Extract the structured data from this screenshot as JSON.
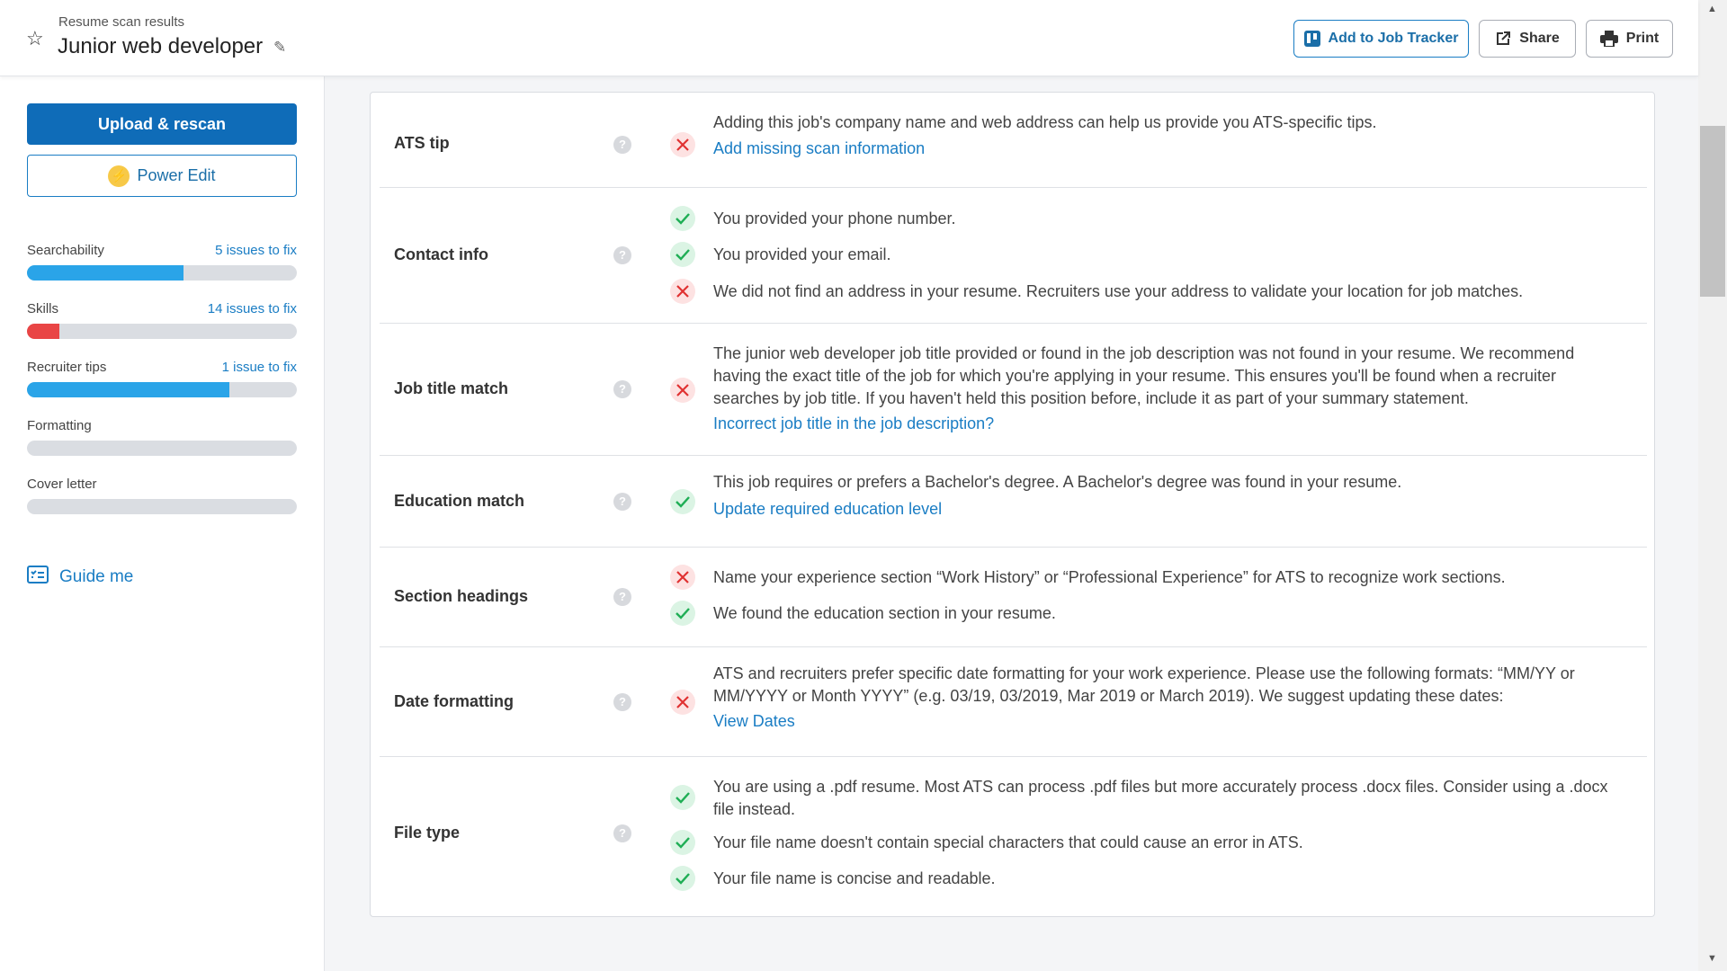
{
  "header": {
    "subtitle": "Resume scan results",
    "title": "Junior web developer",
    "buttons": {
      "job_tracker": "Add to Job Tracker",
      "share": "Share",
      "print": "Print"
    }
  },
  "sidebar": {
    "upload_label": "Upload & rescan",
    "power_edit_label": "Power Edit",
    "metrics": [
      {
        "label": "Searchability",
        "issues": "5 issues to fix",
        "progress": 0.58,
        "color": "#2aa4e8"
      },
      {
        "label": "Skills",
        "issues": "14 issues to fix",
        "progress": 0.12,
        "color": "#e94545"
      },
      {
        "label": "Recruiter tips",
        "issues": "1 issue to fix",
        "progress": 0.75,
        "color": "#2aa4e8"
      },
      {
        "label": "Formatting",
        "issues": "",
        "progress": 0,
        "color": "#2aa4e8"
      },
      {
        "label": "Cover letter",
        "issues": "",
        "progress": 0,
        "color": "#2aa4e8"
      }
    ],
    "guide_label": "Guide me"
  },
  "results": [
    {
      "label": "ATS tip",
      "items": [
        {
          "status": "fail",
          "text": "Adding this job's company name and web address can help us provide you ATS-specific tips."
        }
      ],
      "link": "Add missing scan information"
    },
    {
      "label": "Contact info",
      "items": [
        {
          "status": "pass",
          "text": "You provided your phone number."
        },
        {
          "status": "pass",
          "text": "You provided your email."
        },
        {
          "status": "fail",
          "text": "We did not find an address in your resume. Recruiters use your address to validate your location for job matches."
        }
      ]
    },
    {
      "label": "Job title match",
      "items": [
        {
          "status": "fail",
          "text": "The junior web developer job title provided or found in the job description was not found in your resume. We recommend having the exact title of the job for which you're applying in your resume. This ensures you'll be found when a recruiter searches by job title. If you haven't held this position before, include it as part of your summary statement."
        }
      ],
      "link": "Incorrect job title in the job description?"
    },
    {
      "label": "Education match",
      "items": [
        {
          "status": "pass",
          "text": "This job requires or prefers a Bachelor's degree. A Bachelor's degree was found in your resume."
        }
      ],
      "link": "Update required education level"
    },
    {
      "label": "Section headings",
      "items": [
        {
          "status": "fail",
          "text": "Name your experience section “Work History” or “Professional Experience” for ATS to recognize work sections."
        },
        {
          "status": "pass",
          "text": "We found the education section in your resume."
        }
      ]
    },
    {
      "label": "Date formatting",
      "items": [
        {
          "status": "fail",
          "text": "ATS and recruiters prefer specific date formatting for your work experience. Please use the following formats: “MM/YY or MM/YYYY or Month YYYY” (e.g. 03/19, 03/2019, Mar 2019 or March 2019). We suggest updating these dates:"
        }
      ],
      "link": "View Dates"
    },
    {
      "label": "File type",
      "items": [
        {
          "status": "pass",
          "text": "You are using a .pdf resume. Most ATS can process .pdf files but more accurately process .docx files. Consider using a .docx file instead."
        },
        {
          "status": "pass",
          "text": "Your file name doesn't contain special characters that could cause an error in ATS."
        },
        {
          "status": "pass",
          "text": "Your file name is concise and readable."
        }
      ]
    }
  ],
  "icons": {
    "star": "star-icon",
    "pencil": "pencil-icon",
    "tracker": "tracker-icon",
    "share": "share-icon",
    "print": "print-icon",
    "bolt": "bolt-icon",
    "guide": "checklist-icon",
    "help": "help-icon",
    "pass": "check-icon",
    "fail": "x-icon"
  }
}
